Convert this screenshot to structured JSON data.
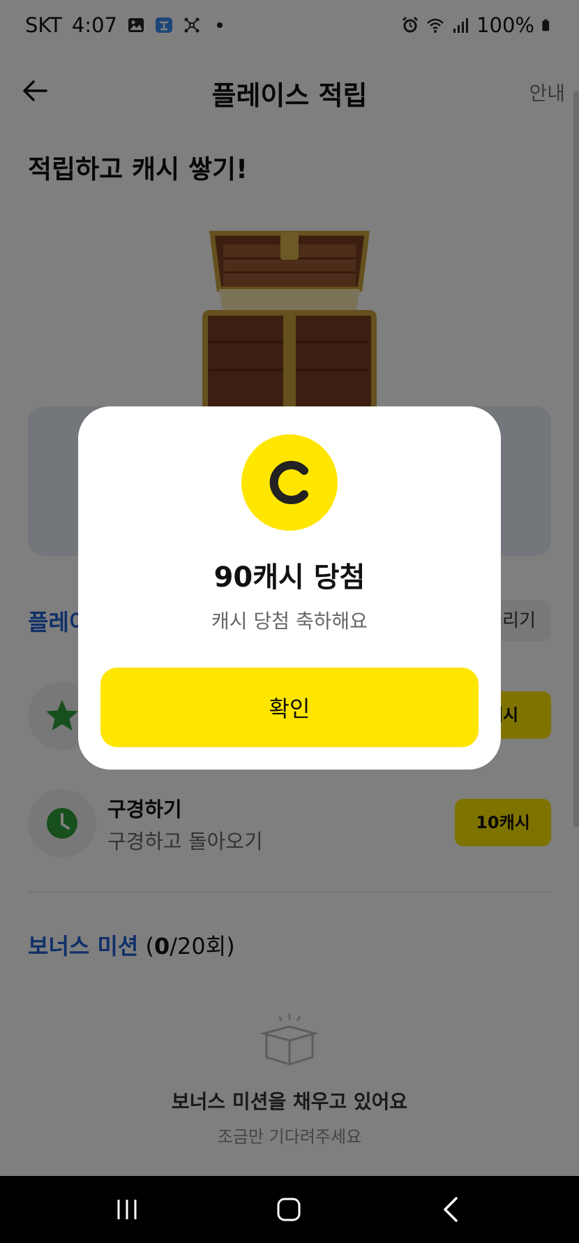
{
  "status_bar": {
    "carrier": "SKT",
    "time": "4:07",
    "battery": "100%"
  },
  "header": {
    "title": "플레이스 적립",
    "guide": "안내"
  },
  "hero": {
    "title": "적립하고 캐시 쌓기!"
  },
  "section": {
    "title": "플레이",
    "more": "늘리기"
  },
  "missions": [
    {
      "title": "",
      "desc": "",
      "reward": "캐시",
      "icon": "star-icon"
    },
    {
      "title": "구경하기",
      "desc": "구경하고 돌아오기",
      "reward": "10캐시",
      "icon": "clock-icon"
    }
  ],
  "bonus": {
    "title": "보너스 미션",
    "count_open": "(",
    "count_current": "0",
    "count_rest": "/20회)",
    "empty_title": "보너스 미션을 채우고 있어요",
    "empty_sub": "조금만 기다려주세요"
  },
  "modal": {
    "coin_letter": "C",
    "title": "90캐시 당첨",
    "subtitle": "캐시 당첨 축하해요",
    "confirm": "확인"
  },
  "colors": {
    "accent_yellow": "#ffe600",
    "accent_blue": "#1f5fd0",
    "icon_green": "#2e9e3a"
  }
}
